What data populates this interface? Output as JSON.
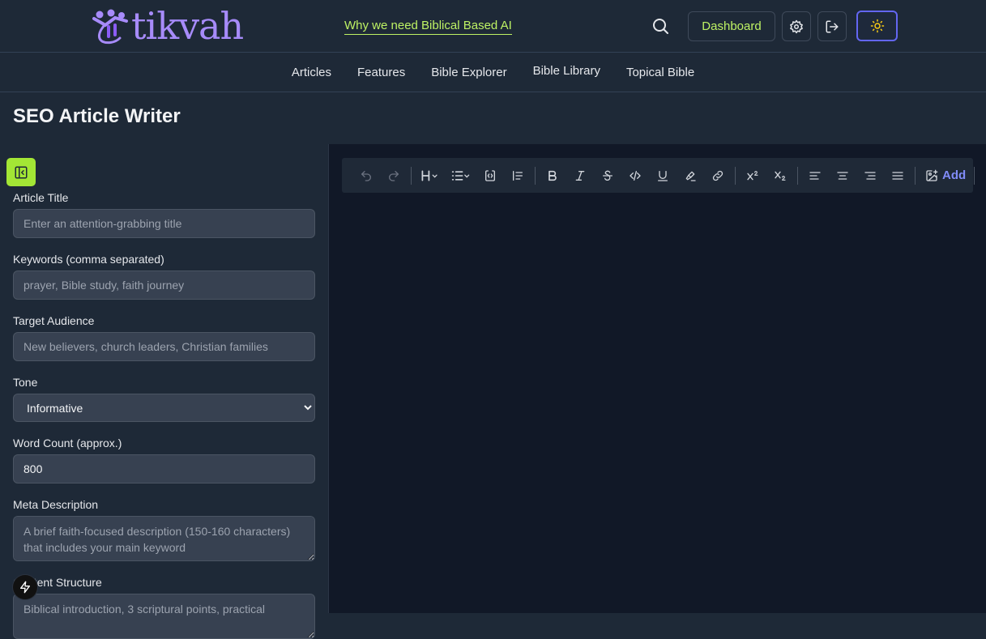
{
  "brand": {
    "name": "tikvah"
  },
  "header": {
    "promo_link": "Why we need Biblical Based AI",
    "dashboard_label": "Dashboard"
  },
  "nav": {
    "items": [
      {
        "label": "Articles"
      },
      {
        "label": "Features"
      },
      {
        "label": "Bible Explorer"
      },
      {
        "label": "Bible Library"
      },
      {
        "label": "Topical Bible"
      }
    ]
  },
  "page": {
    "title": "SEO Article Writer"
  },
  "form": {
    "title_label": "Article Title",
    "title_placeholder": "Enter an attention-grabbing title",
    "keywords_label": "Keywords (comma separated)",
    "keywords_placeholder": "prayer, Bible study, faith journey",
    "audience_label": "Target Audience",
    "audience_placeholder": "New believers, church leaders, Christian families",
    "tone_label": "Tone",
    "tone_value": "Informative",
    "wordcount_label": "Word Count (approx.)",
    "wordcount_value": "800",
    "meta_label": "Meta Description",
    "meta_placeholder": "A brief faith-focused description (150-160 characters) that includes your main keyword",
    "structure_label": "Content Structure",
    "structure_placeholder": "Biblical introduction, 3 scriptural points, practical"
  },
  "editor": {
    "add_label": "Add"
  },
  "colors": {
    "accent_lime": "#bef264",
    "brand_purple": "#a78bfa",
    "indigo": "#818cf8",
    "background": "#1e2937",
    "editor_bg": "#111827"
  }
}
